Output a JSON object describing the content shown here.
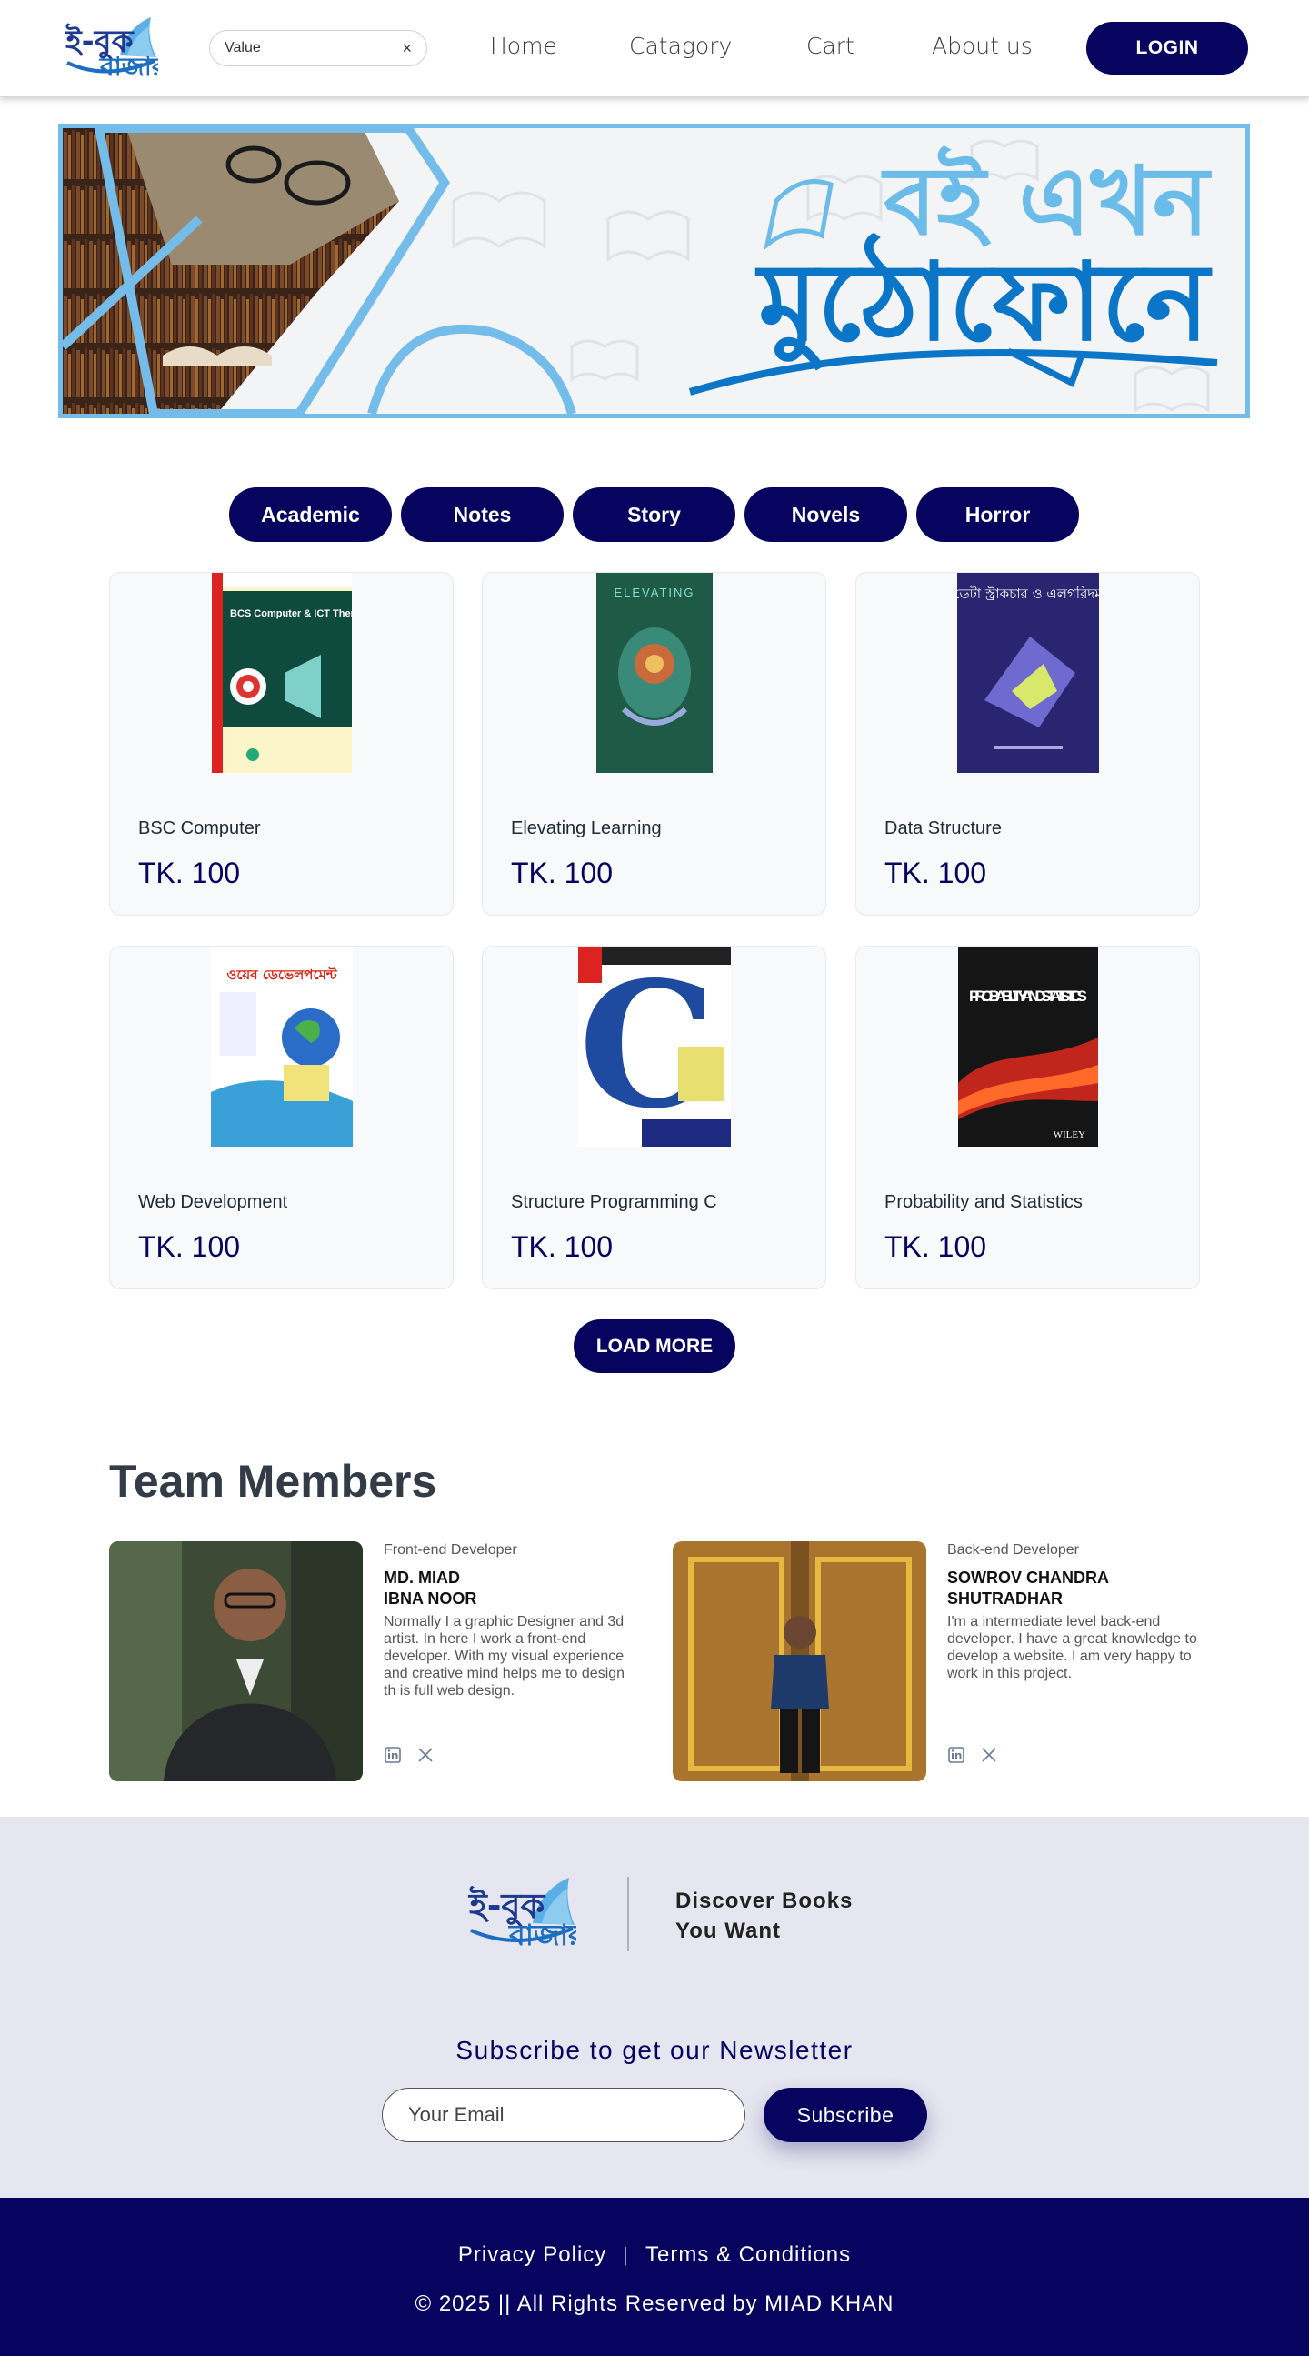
{
  "header": {
    "logo_text": "ই-বুক বাজার",
    "search": {
      "value": "Value",
      "clear_symbol": "×"
    },
    "nav": [
      "Home",
      "Catagory",
      "Cart",
      "About us"
    ],
    "login_label": "LOGIN"
  },
  "banner": {
    "line1": "বই এখন",
    "line2": "মুঠোফোনে"
  },
  "categories": [
    "Academic",
    "Notes",
    "Story",
    "Novels",
    "Horror"
  ],
  "books": [
    {
      "title": "BSC Computer",
      "price": "TK. 100",
      "cover_text": "BCS Computer & ICT Therapy"
    },
    {
      "title": "Elevating Learning",
      "price": "TK. 100",
      "cover_text": "ELEVATING"
    },
    {
      "title": "Data Structure",
      "price": "TK. 100",
      "cover_text": "ডেটা স্ট্রাকচার ও এলগরিদম"
    },
    {
      "title": "Web Development",
      "price": "TK. 100",
      "cover_text": "ওয়েব ডেভেলপমেন্ট"
    },
    {
      "title": "Structure Programming C",
      "price": "TK. 100",
      "cover_text": "C"
    },
    {
      "title": "Probability and Statistics",
      "price": "TK. 100",
      "cover_text": "PROBABILITY AND STATISTICS"
    }
  ],
  "load_more_label": "LOAD MORE",
  "team": {
    "title": "Team Members",
    "members": [
      {
        "role": "Front-end Developer",
        "name_line1": "MD. MIAD",
        "name_line2": "IBNA NOOR",
        "bio": "Normally I a graphic Designer and 3d artist. In here I work a front-end developer. With my visual experience and creative mind helps me to design th is full web design."
      },
      {
        "role": "Back-end Developer",
        "name_line1": "SOWROV CHANDRA",
        "name_line2": "SHUTRADHAR",
        "bio": "I'm a intermediate level back-end developer. I have a great knowledge to develop a  website. I am very happy to work in this project."
      }
    ]
  },
  "footer": {
    "tagline_line1": "Discover Books",
    "tagline_line2": "You Want",
    "newsletter_title": "Subscribe to get our Newsletter",
    "email_placeholder": "Your Email",
    "subscribe_label": "Subscribe",
    "privacy_label": "Privacy Policy",
    "terms_label": "Terms & Conditions",
    "copyright": "© 2025 || All Rights Reserved by MIAD KHAN"
  },
  "colors": {
    "primary": "#06045f",
    "banner_light": "#74bdea",
    "banner_dark": "#0b75c7",
    "footer_bg": "#e6e6f0"
  }
}
